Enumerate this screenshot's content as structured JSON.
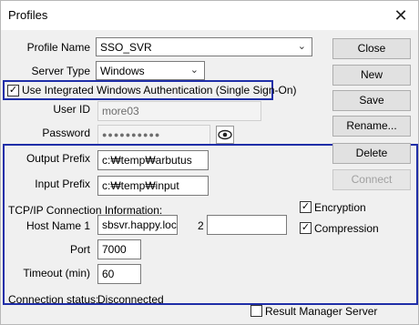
{
  "window": {
    "title": "Profiles",
    "close_glyph": "✕"
  },
  "profile": {
    "label": "Profile Name",
    "value": "SSO_SVR",
    "server_type_label": "Server Type",
    "server_type_value": "Windows"
  },
  "auth": {
    "integrated_label": "Use Integrated Windows Authentication (Single Sign-On)",
    "integrated_checked": true,
    "user_id_label": "User ID",
    "user_id_value": "more03",
    "password_label": "Password",
    "password_value": "●●●●●●●●●●",
    "eye_icon": "eye-icon"
  },
  "paths": {
    "output_label": "Output Prefix",
    "output_value": "c:₩temp₩arbutus",
    "input_label": "Input Prefix",
    "input_value": "c:₩temp₩input"
  },
  "connection": {
    "section_label": "TCP/IP Connection Information:",
    "host_label": "Host Name 1",
    "host_value": "sbsvr.happy.local",
    "host2_label": "2",
    "host2_value": "",
    "port_label": "Port",
    "port_value": "7000",
    "timeout_label": "Timeout (min)",
    "timeout_value": "60",
    "encryption_label": "Encryption",
    "compression_label": "Compression",
    "status_label": "Connection status:",
    "status_value": "Disconnected"
  },
  "result_manager": {
    "label": "Result Manager Server",
    "checked": false
  },
  "buttons": {
    "close": "Close",
    "new": "New",
    "save": "Save",
    "rename": "Rename...",
    "delete": "Delete",
    "connect": "Connect"
  },
  "colors": {
    "highlight_border": "#1f2ea8"
  }
}
